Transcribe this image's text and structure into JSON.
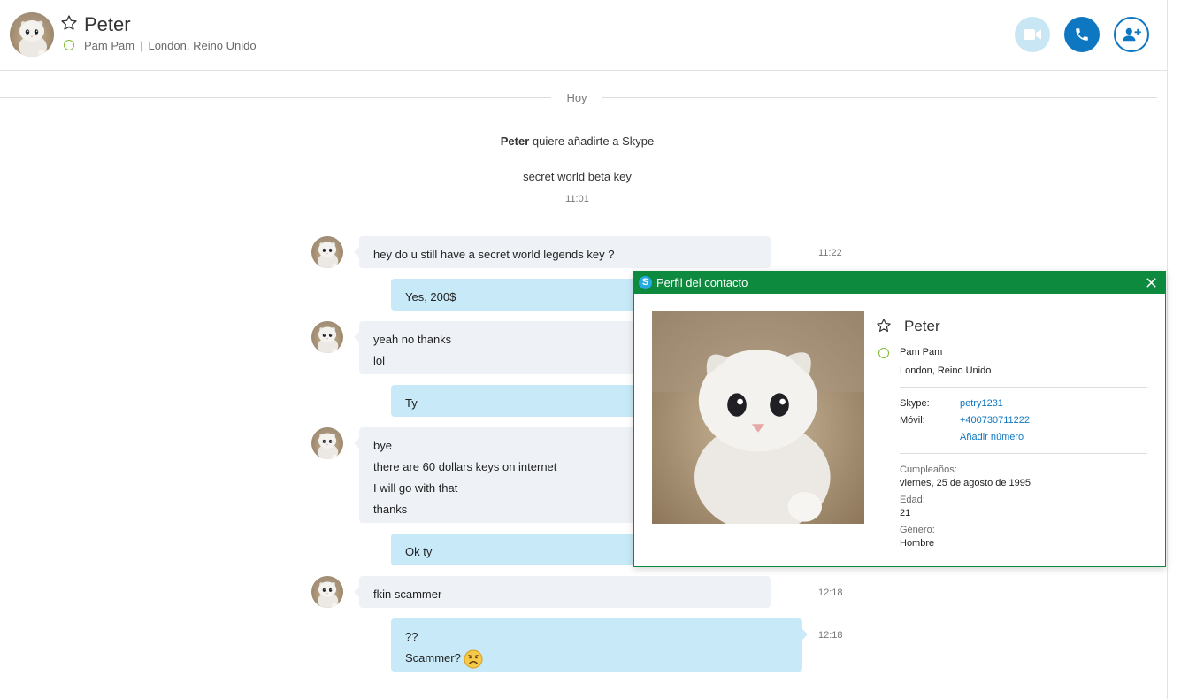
{
  "header": {
    "name": "Peter",
    "display_name": "Pam Pam",
    "separator": "|",
    "location": "London, Reino Unido",
    "status": "online"
  },
  "day_divider": "Hoy",
  "system": {
    "request_name": "Peter",
    "request_text": " quiere añadirte a Skype",
    "request_message": "secret world beta key",
    "request_time": "11:01"
  },
  "messages": [
    {
      "dir": "in",
      "lines": [
        "hey do u still have a secret world legends key ?"
      ],
      "time": "11:22"
    },
    {
      "dir": "out",
      "lines": [
        "Yes, 200$"
      ],
      "time": ""
    },
    {
      "dir": "in",
      "lines": [
        "yeah no thanks",
        "lol"
      ],
      "time": ""
    },
    {
      "dir": "out",
      "lines": [
        "Ty"
      ],
      "time": ""
    },
    {
      "dir": "in",
      "lines": [
        "bye",
        "there are 60 dollars keys on internet",
        "I will go with that",
        "thanks"
      ],
      "time": ""
    },
    {
      "dir": "out",
      "lines": [
        "Ok ty"
      ],
      "time": ""
    },
    {
      "dir": "in",
      "lines": [
        "fkin scammer"
      ],
      "time": "12:18"
    },
    {
      "dir": "out",
      "lines": [
        "??",
        "Scammer?"
      ],
      "time": "12:18",
      "emoji": "worried-face-icon"
    }
  ],
  "profile": {
    "title": "Perfil del contacto",
    "logo_letter": "S",
    "name": "Peter",
    "display_name": "Pam Pam",
    "location": "London, Reino Unido",
    "skype_label": "Skype:",
    "skype_value": "petry1231",
    "mobile_label": "Móvil:",
    "mobile_value": "+400730711222",
    "add_number": "Añadir número",
    "birthday_label": "Cumpleaños:",
    "birthday_value": "viernes, 25 de agosto de 1995",
    "age_label": "Edad:",
    "age_value": "21",
    "gender_label": "Género:",
    "gender_value": "Hombre"
  },
  "colors": {
    "accent": "#0e77c1",
    "popup_green": "#0e8a3f",
    "incoming_bubble": "#eef2f6",
    "outgoing_bubble": "#c7e9f8",
    "online": "#7cbb2f"
  }
}
